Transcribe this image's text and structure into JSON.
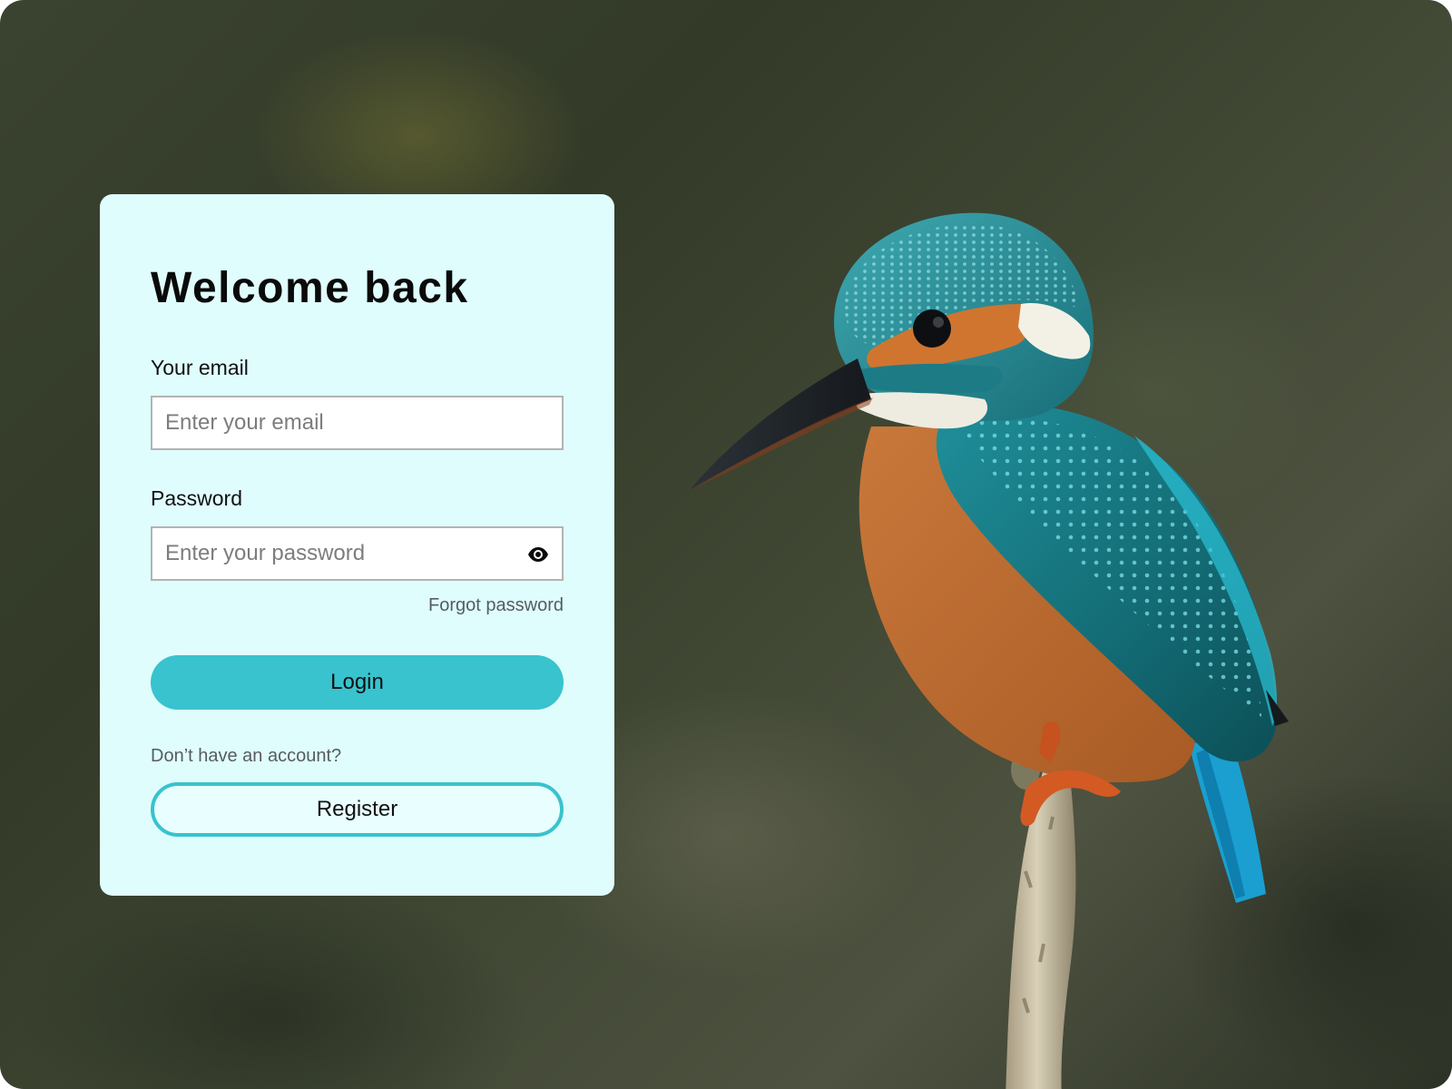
{
  "login": {
    "title": "Welcome back",
    "email_label": "Your email",
    "email_placeholder": "Enter your email",
    "email_value": "",
    "password_label": "Password",
    "password_placeholder": "Enter your password",
    "password_value": "",
    "forgot_label": "Forgot password",
    "login_label": "Login",
    "no_account_text": "Don’t have an account?",
    "register_label": "Register"
  },
  "icons": {
    "password_toggle": "eye-icon"
  },
  "background": {
    "subject": "kingfisher"
  },
  "colors": {
    "card_background": "#e0fdfe",
    "accent": "#38c3ce",
    "title_text": "#0a0a0a",
    "muted_text": "#555d5f"
  }
}
